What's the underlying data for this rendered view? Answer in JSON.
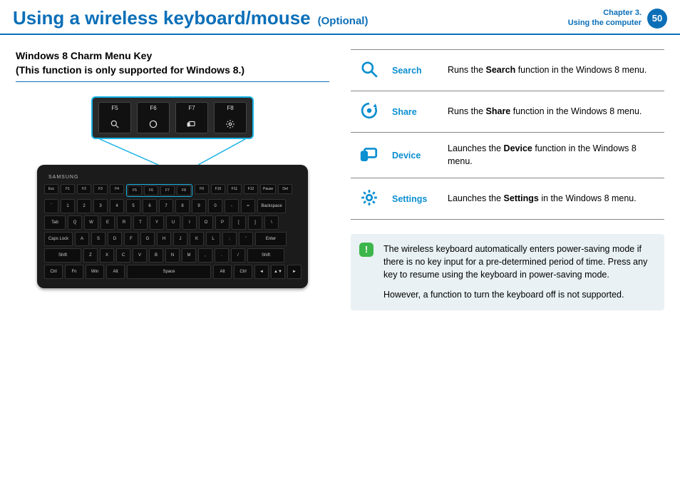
{
  "header": {
    "title": "Using a wireless keyboard/mouse",
    "subtitle": "(Optional)",
    "chapter_line1": "Chapter 3.",
    "chapter_line2": "Using the computer",
    "page_number": "50"
  },
  "section": {
    "heading_line1": "Windows 8 Charm Menu Key",
    "heading_line2": "(This function is only supported for Windows 8.)"
  },
  "keyboard": {
    "brand": "SAMSUNG",
    "callout_keys": [
      "F5",
      "F6",
      "F7",
      "F8"
    ],
    "fn_row": [
      "Esc",
      "F1",
      "F2",
      "F3",
      "F4",
      "F5",
      "F6",
      "F7",
      "F8",
      "F9",
      "F10",
      "F11",
      "F12",
      "Pause",
      "Del"
    ],
    "num_row": [
      "`",
      "1",
      "2",
      "3",
      "4",
      "5",
      "6",
      "7",
      "8",
      "9",
      "0",
      "-",
      "=",
      "Backspace"
    ],
    "row_q": [
      "Tab",
      "Q",
      "W",
      "E",
      "R",
      "T",
      "Y",
      "U",
      "I",
      "O",
      "P",
      "[",
      "]",
      "\\"
    ],
    "row_a": [
      "Caps Lock",
      "A",
      "S",
      "D",
      "F",
      "G",
      "H",
      "J",
      "K",
      "L",
      ";",
      "'",
      "Enter"
    ],
    "row_z": [
      "Shift",
      "Z",
      "X",
      "C",
      "V",
      "B",
      "N",
      "M",
      ",",
      ".",
      "/",
      "Shift"
    ],
    "row_ctrl": [
      "Ctrl",
      "Fn",
      "Win",
      "Alt",
      "Space",
      "Alt",
      "Ctrl",
      "◄",
      "▲▼",
      "►"
    ]
  },
  "charms": [
    {
      "icon": "search",
      "label": "Search",
      "desc_pre": "Runs the ",
      "desc_bold": "Search",
      "desc_post": " function in the Windows 8 menu."
    },
    {
      "icon": "share",
      "label": "Share",
      "desc_pre": "Runs the ",
      "desc_bold": "Share",
      "desc_post": " function in the Windows 8 menu."
    },
    {
      "icon": "device",
      "label": "Device",
      "desc_pre": "Launches the ",
      "desc_bold": "Device",
      "desc_post": " function in the Windows 8 menu."
    },
    {
      "icon": "settings",
      "label": "Settings",
      "desc_pre": "Launches the ",
      "desc_bold": "Settings",
      "desc_post": " in the Windows 8 menu."
    }
  ],
  "note": {
    "badge": "!",
    "p1": "The wireless keyboard automatically enters power-saving mode if there is no key input for a pre-determined period of time. Press any key to resume using the keyboard in power-saving mode.",
    "p2": "However, a function to turn the keyboard off is not supported."
  }
}
